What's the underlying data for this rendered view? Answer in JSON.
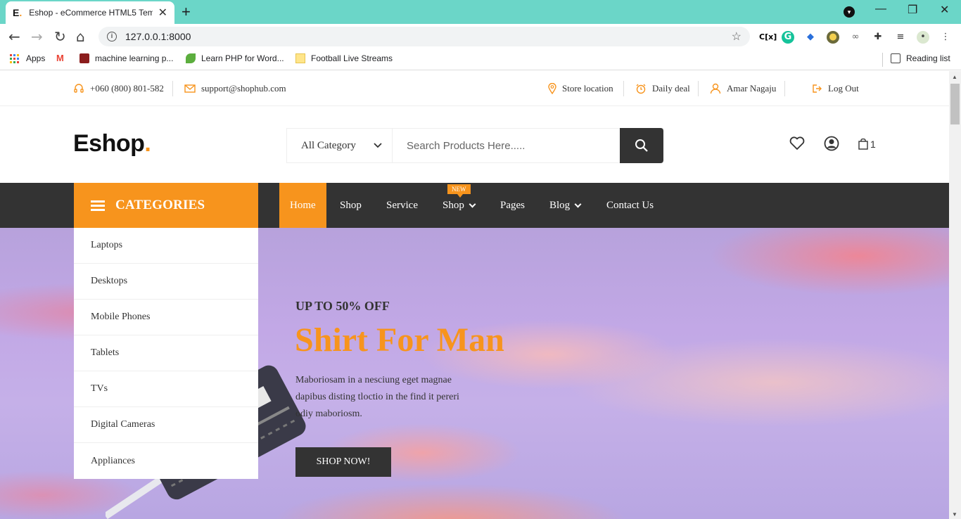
{
  "browser": {
    "tab_title": "Eshop - eCommerce HTML5 Tem",
    "tab_favicon": "E.",
    "url": "127.0.0.1:8000",
    "bookmarks": [
      {
        "label": "Apps",
        "icon": "apps-grid-icon"
      },
      {
        "label": "",
        "icon": "gmail-icon"
      },
      {
        "label": "machine learning p...",
        "icon": "ml-icon"
      },
      {
        "label": "Learn PHP for Word...",
        "icon": "leaf-icon"
      },
      {
        "label": "Football Live Streams",
        "icon": "folder-icon"
      }
    ],
    "reading_list": "Reading list"
  },
  "topbar": {
    "phone": "+060 (800) 801-582",
    "email": "support@shophub.com",
    "store_location": "Store location",
    "daily_deal": "Daily deal",
    "user": "Amar Nagaju",
    "logout": "Log Out"
  },
  "header": {
    "logo_text": "Eshop",
    "logo_dot": ".",
    "category_select": "All Category",
    "search_placeholder": "Search Products Here.....",
    "cart_count": "1"
  },
  "nav": {
    "categories_label": "CATEGORIES",
    "items": [
      "Home",
      "Shop",
      "Service",
      "Shop",
      "Pages",
      "Blog",
      "Contact Us"
    ],
    "badge": "NEW"
  },
  "categories": [
    "Laptops",
    "Desktops",
    "Mobile Phones",
    "Tablets",
    "TVs",
    "Digital Cameras",
    "Appliances"
  ],
  "hero": {
    "subtitle": "UP TO 50% OFF",
    "title": "Shirt For Man",
    "description": "Maboriosam in a nesciung eget magnae dapibus disting tloctio in the find it pereri odiy maboriosm.",
    "button": "SHOP NOW!"
  },
  "colors": {
    "accent": "#f7941d",
    "dark": "#333333",
    "tab_strip": "#6bd6c8"
  }
}
